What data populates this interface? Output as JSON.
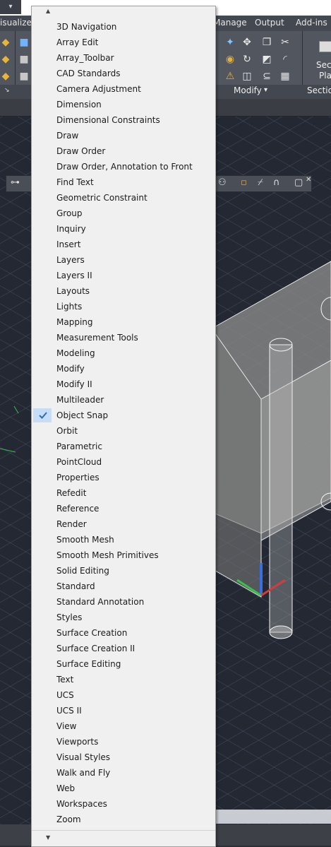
{
  "ribbon": {
    "tabs": [
      {
        "label": "isualize"
      },
      {
        "label": "Manage"
      },
      {
        "label": "Output"
      },
      {
        "label": "Add-ins"
      }
    ],
    "panels": {
      "modify": "Modify",
      "section": "Section",
      "section_btn_line1": "Sect",
      "section_btn_line2": "Pla"
    }
  },
  "menu": {
    "items": [
      {
        "label": "3D Navigation",
        "checked": false
      },
      {
        "label": "Array Edit",
        "checked": false
      },
      {
        "label": "Array_Toolbar",
        "checked": false
      },
      {
        "label": "CAD Standards",
        "checked": false
      },
      {
        "label": "Camera Adjustment",
        "checked": false
      },
      {
        "label": "Dimension",
        "checked": false
      },
      {
        "label": "Dimensional Constraints",
        "checked": false
      },
      {
        "label": "Draw",
        "checked": false
      },
      {
        "label": "Draw Order",
        "checked": false
      },
      {
        "label": "Draw Order, Annotation to Front",
        "checked": false
      },
      {
        "label": "Find Text",
        "checked": false
      },
      {
        "label": "Geometric Constraint",
        "checked": false
      },
      {
        "label": "Group",
        "checked": false
      },
      {
        "label": "Inquiry",
        "checked": false
      },
      {
        "label": "Insert",
        "checked": false
      },
      {
        "label": "Layers",
        "checked": false
      },
      {
        "label": "Layers II",
        "checked": false
      },
      {
        "label": "Layouts",
        "checked": false
      },
      {
        "label": "Lights",
        "checked": false
      },
      {
        "label": "Mapping",
        "checked": false
      },
      {
        "label": "Measurement Tools",
        "checked": false
      },
      {
        "label": "Modeling",
        "checked": false
      },
      {
        "label": "Modify",
        "checked": false
      },
      {
        "label": "Modify II",
        "checked": false
      },
      {
        "label": "Multileader",
        "checked": false
      },
      {
        "label": "Object Snap",
        "checked": true
      },
      {
        "label": "Orbit",
        "checked": false
      },
      {
        "label": "Parametric",
        "checked": false
      },
      {
        "label": "PointCloud",
        "checked": false
      },
      {
        "label": "Properties",
        "checked": false
      },
      {
        "label": "Refedit",
        "checked": false
      },
      {
        "label": "Reference",
        "checked": false
      },
      {
        "label": "Render",
        "checked": false
      },
      {
        "label": "Smooth Mesh",
        "checked": false
      },
      {
        "label": "Smooth Mesh Primitives",
        "checked": false
      },
      {
        "label": "Solid Editing",
        "checked": false
      },
      {
        "label": "Standard",
        "checked": false
      },
      {
        "label": "Standard Annotation",
        "checked": false
      },
      {
        "label": "Styles",
        "checked": false
      },
      {
        "label": "Surface Creation",
        "checked": false
      },
      {
        "label": "Surface Creation II",
        "checked": false
      },
      {
        "label": "Surface Editing",
        "checked": false
      },
      {
        "label": "Text",
        "checked": false
      },
      {
        "label": "UCS",
        "checked": false
      },
      {
        "label": "UCS II",
        "checked": false
      },
      {
        "label": "View",
        "checked": false
      },
      {
        "label": "Viewports",
        "checked": false
      },
      {
        "label": "Visual Styles",
        "checked": false
      },
      {
        "label": "Walk and Fly",
        "checked": false
      },
      {
        "label": "Web",
        "checked": false
      },
      {
        "label": "Workspaces",
        "checked": false
      },
      {
        "label": "Zoom",
        "checked": false
      }
    ]
  },
  "colors": {
    "menu_bg": "#f0f0f0",
    "check_highlight": "#c6ddf5",
    "check_mark": "#2a6ebb",
    "viewport_bg": "#232833",
    "ribbon_bg": "#52565f"
  }
}
